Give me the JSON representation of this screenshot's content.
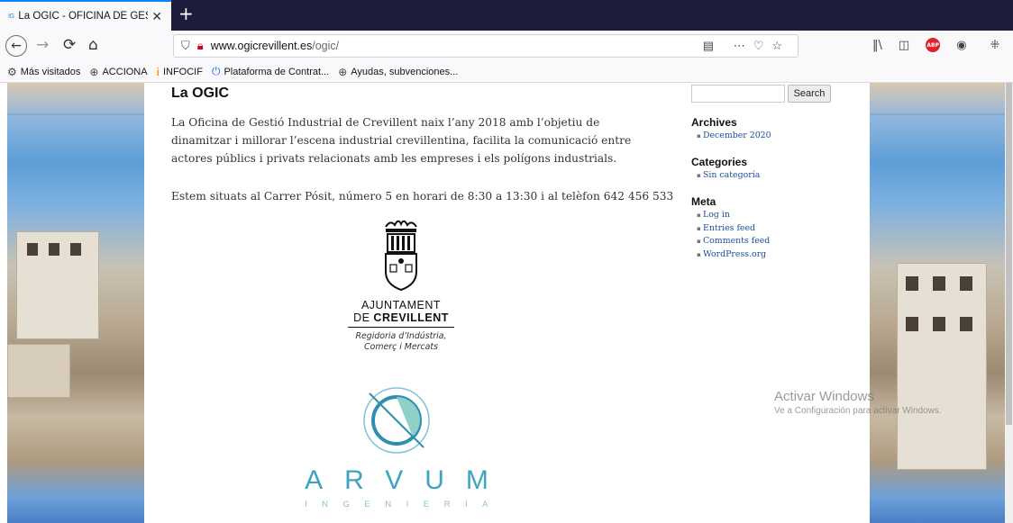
{
  "browser": {
    "tab": {
      "favicon": "IG",
      "title": "La OGIC - OFICINA DE GESTIÓ I",
      "close": "✕"
    },
    "new_tab": "+",
    "url": {
      "host": "www.ogicrevillent.es",
      "path": "/ogic/"
    },
    "bookmarks": [
      {
        "icon": "gear-icon",
        "label": "Más visitados"
      },
      {
        "icon": "globe-icon",
        "label": "ACCIONA"
      },
      {
        "icon": "info-icon",
        "label": "INFOCIF"
      },
      {
        "icon": "power-icon",
        "label": "Plataforma de Contrat..."
      },
      {
        "icon": "globe-icon",
        "label": "Ayudas, subvenciones..."
      }
    ],
    "abp_label": "ABP"
  },
  "content": {
    "title": "La OGIC",
    "paragraph1": "La Oficina de Gestió Industrial de Crevillent naix l’any 2018 amb l’objetiu de dinamitzar i millorar l’escena industrial crevillentina, facilita la comunicació entre actores públics i privats relacionats amb les empreses i els polígons industrials.",
    "paragraph2": "Estem situats al Carrer Pósit, número 5 en horari de 8:30 a 13:30 i al telèfon 642 456 533",
    "logo_ajuntament": {
      "line1": "AJUNTAMENT",
      "line2_prefix": "DE ",
      "line2_bold": "CREVILLENT",
      "sub1": "Regidoria d’Indústria,",
      "sub2": "Comerç i Mercats"
    },
    "logo_arvum": {
      "word": "ARVUM",
      "sub": "INGENIERÍA"
    }
  },
  "sidebar": {
    "search_button": "Search",
    "archives_title": "Archives",
    "archives": [
      "December 2020"
    ],
    "categories_title": "Categories",
    "categories": [
      "Sin categoría"
    ],
    "meta_title": "Meta",
    "meta": [
      "Log in",
      "Entries feed",
      "Comments feed",
      "WordPress.org"
    ]
  },
  "watermark": {
    "line1": "Activar Windows",
    "line2": "Ve a Configuración para activar Windows."
  },
  "colors": {
    "tabbar": "#1d1d3b",
    "link": "#1b4f9a",
    "arvum": "#3fa3c0"
  }
}
